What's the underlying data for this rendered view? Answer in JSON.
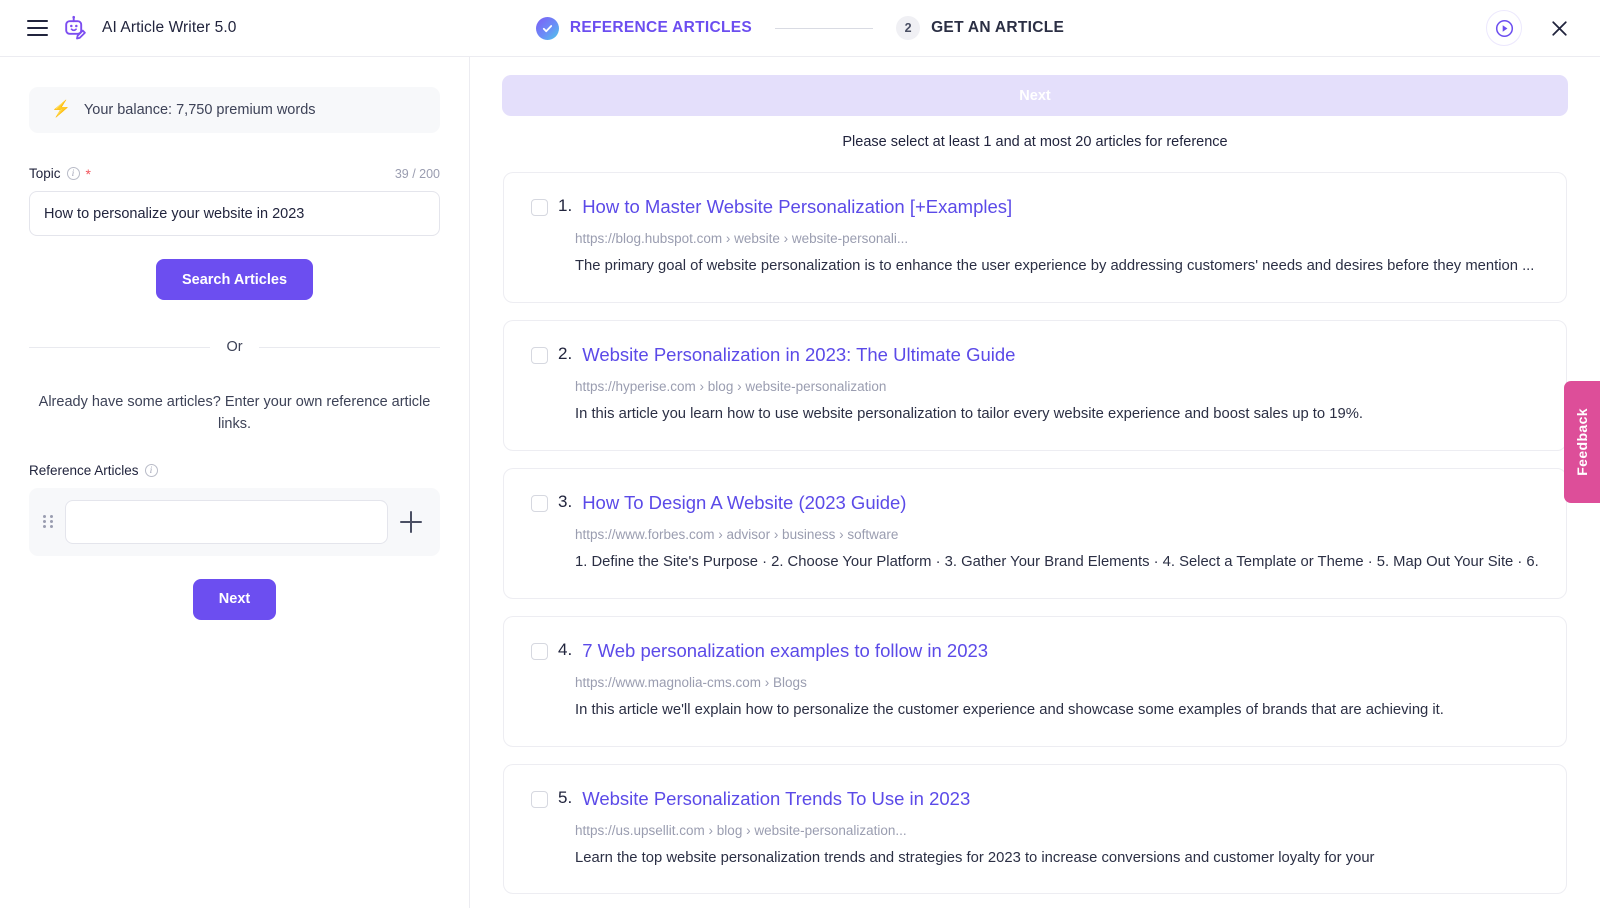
{
  "header": {
    "menu_icon": "hamburger-menu-icon",
    "logo_icon": "robot-pencil-logo-icon",
    "app_title": "AI Article Writer 5.0",
    "steps": [
      {
        "label": "REFERENCE ARTICLES",
        "state": "done",
        "marker": "check-icon"
      },
      {
        "label": "GET AN ARTICLE",
        "state": "current",
        "marker": "2"
      }
    ],
    "play_icon": "play-circle-icon",
    "close_icon": "close-icon"
  },
  "sidebar": {
    "balance": {
      "icon": "lightning-bolt-icon",
      "text": "Your balance: 7,750 premium words"
    },
    "topic": {
      "label": "Topic",
      "info_icon": "info-icon",
      "required_mark": "*",
      "counter": "39 / 200",
      "value": "How to personalize your website in 2023",
      "placeholder": ""
    },
    "search_button": "Search Articles",
    "divider_label": "Or",
    "helper_text": "Already have some articles? Enter your own reference article links.",
    "reference": {
      "label": "Reference Articles",
      "info_icon": "info-icon",
      "drag_icon": "drag-handle-icon",
      "add_icon": "plus-icon",
      "value": "",
      "placeholder": ""
    },
    "next_button": "Next"
  },
  "main": {
    "next_button": "Next",
    "hint": "Please select at least 1 and at most 20 articles for reference",
    "results": [
      {
        "index": "1.",
        "title": "How to Master Website Personalization [+Examples]",
        "url": "https://blog.hubspot.com › website › website-personali...",
        "snippet": "The primary goal of website personalization is to enhance the user experience by addressing customers' needs and desires before they mention ...",
        "checked": false
      },
      {
        "index": "2.",
        "title": "Website Personalization in 2023: The Ultimate Guide",
        "url": "https://hyperise.com › blog › website-personalization",
        "snippet": "In this article you learn how to use website personalization to tailor every website experience and boost sales up to 19%.",
        "checked": false
      },
      {
        "index": "3.",
        "title": "How To Design A Website (2023 Guide)",
        "url": "https://www.forbes.com › advisor › business › software",
        "snippet": "1. Define the Site's Purpose · 2. Choose Your Platform · 3. Gather Your Brand Elements · 4. Select a Template or Theme · 5. Map Out Your Site · 6.",
        "checked": false
      },
      {
        "index": "4.",
        "title": "7 Web personalization examples to follow in 2023",
        "url": "https://www.magnolia-cms.com › Blogs",
        "snippet": "In this article we'll explain how to personalize the customer experience and showcase some examples of brands that are achieving it.",
        "checked": false
      },
      {
        "index": "5.",
        "title": "Website Personalization Trends To Use in 2023",
        "url": "https://us.upsellit.com › blog › website-personalization...",
        "snippet": "Learn the top website personalization trends and strategies for 2023 to increase conversions and customer loyalty for your",
        "checked": false
      }
    ]
  },
  "feedback": {
    "label": "Feedback",
    "color": "#dd4e99"
  },
  "colors": {
    "accent": "#6c4ef0",
    "link": "#5b4ae8",
    "disabled_button": "#e4dffb",
    "required": "#f2545b"
  }
}
